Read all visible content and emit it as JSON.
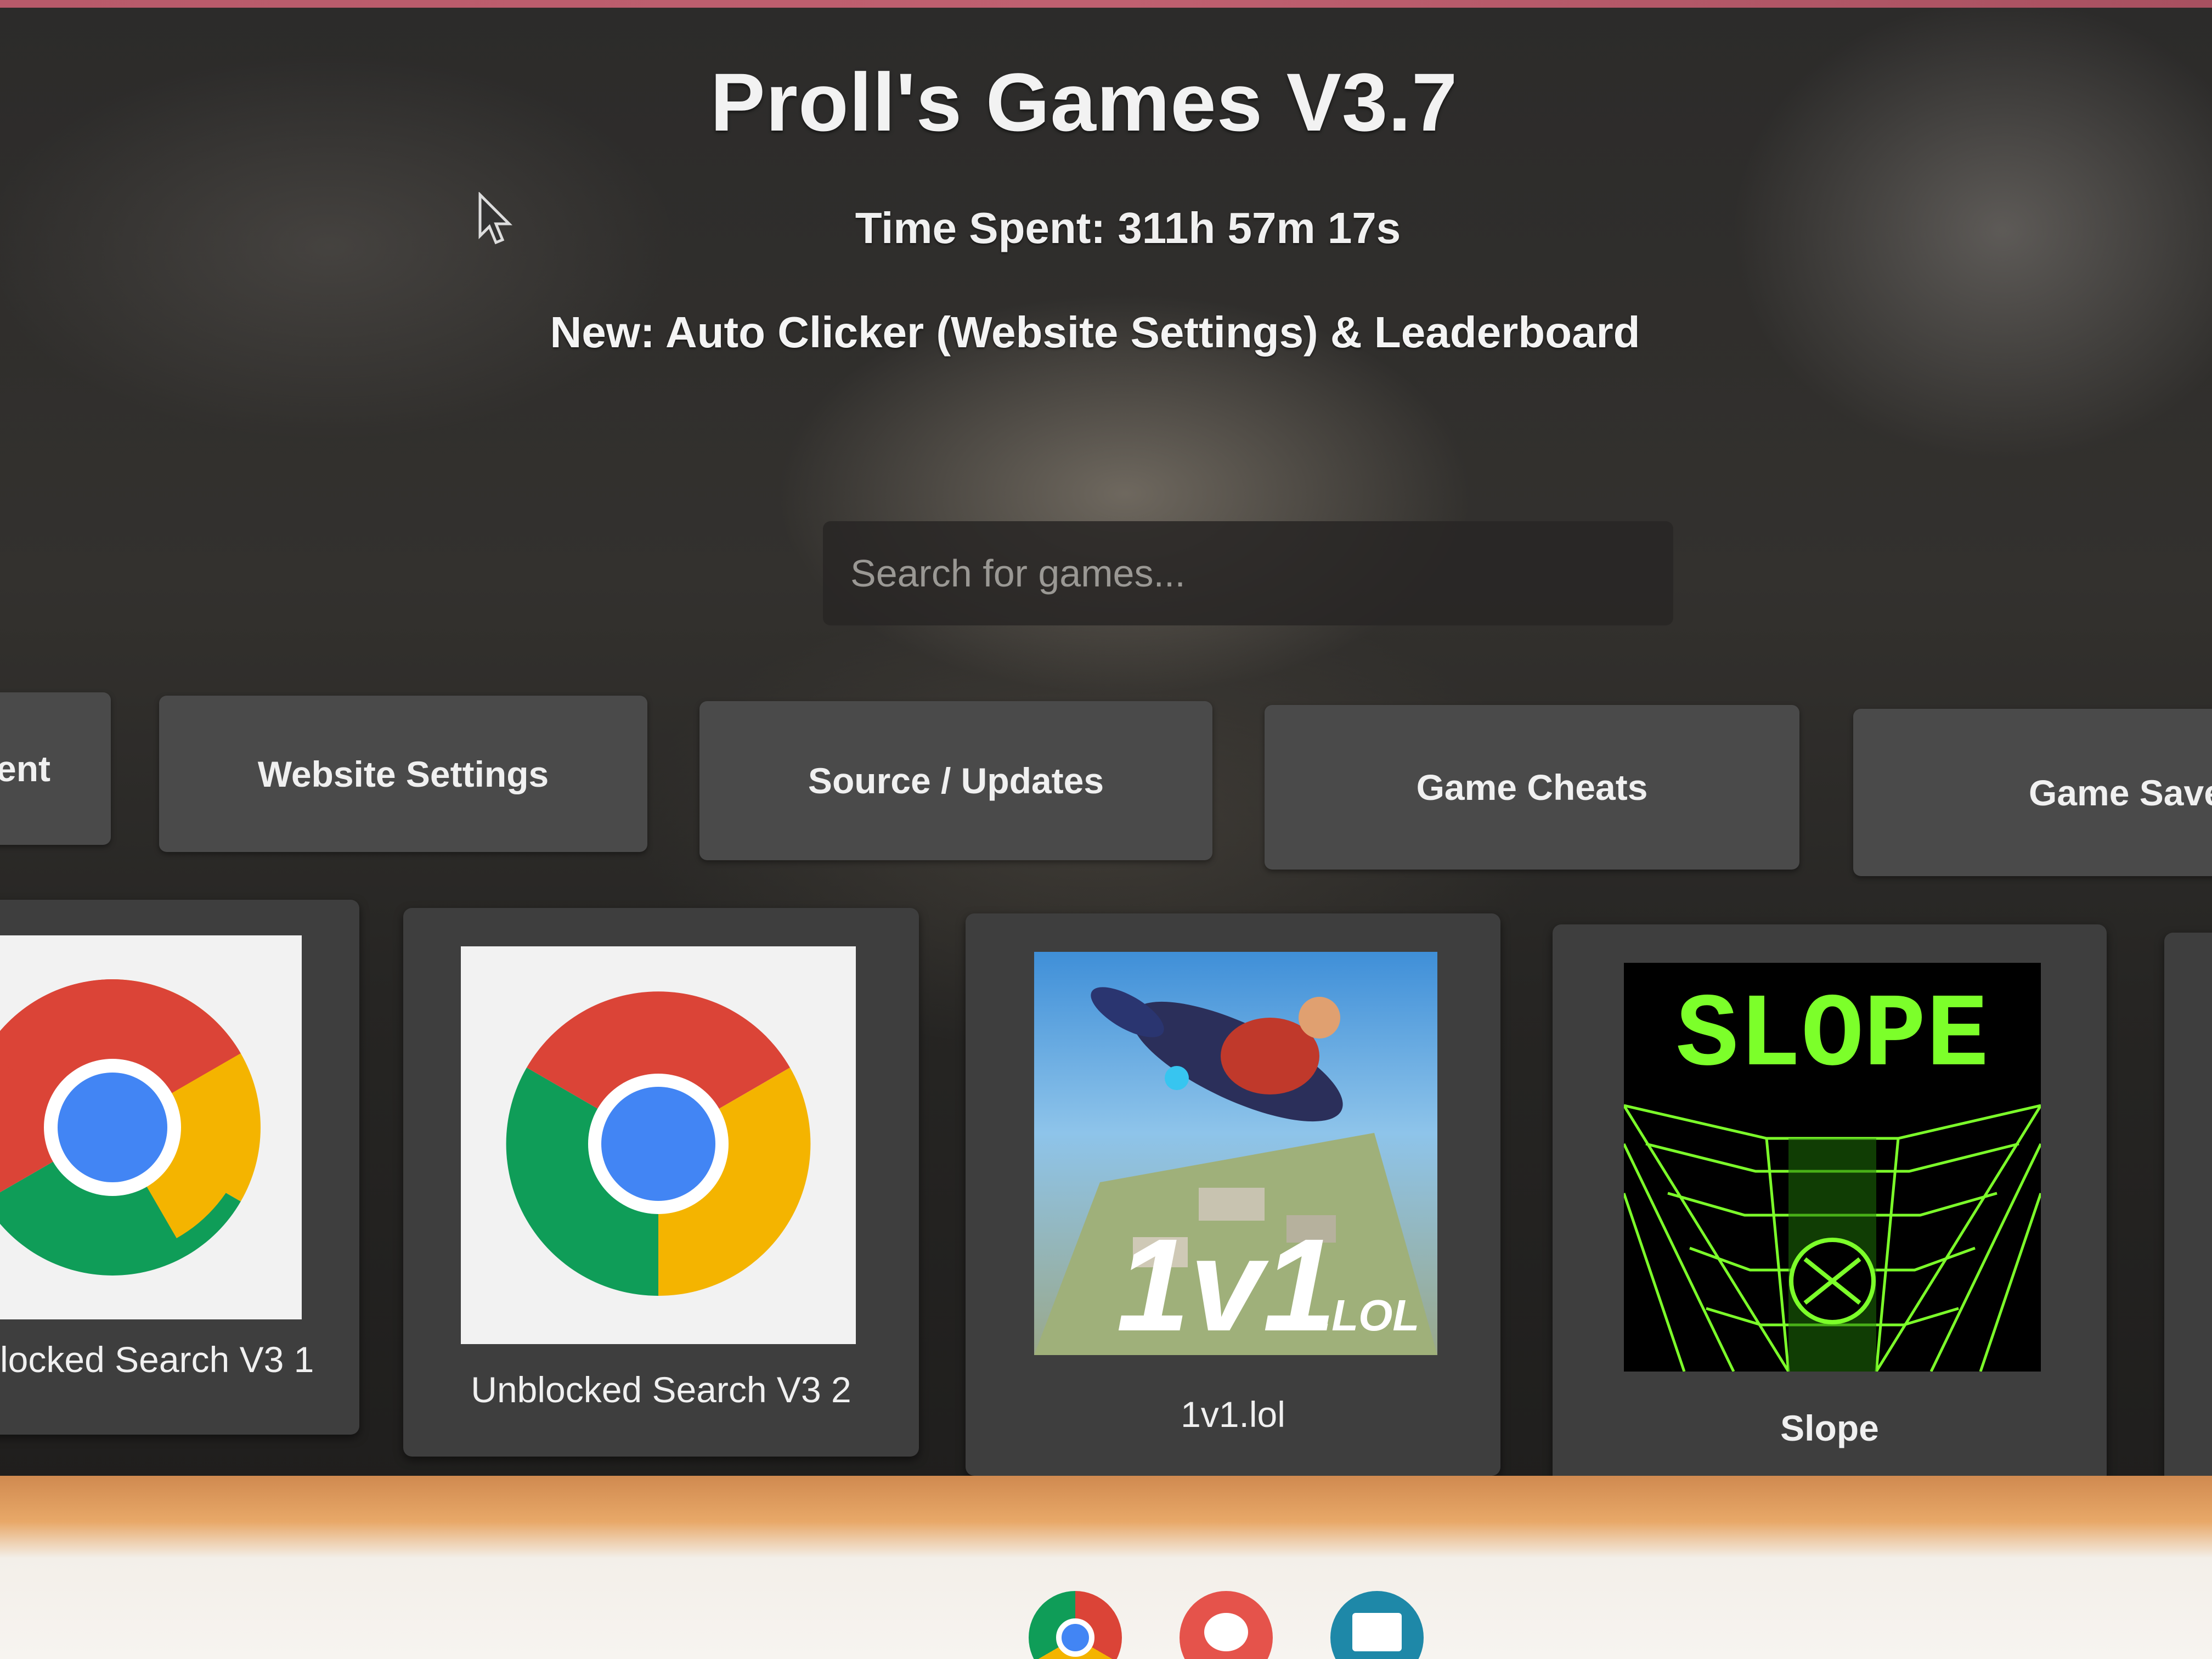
{
  "header": {
    "title": "Proll's Games V3.7",
    "time_spent_label": "Time Spent:",
    "time_spent_value": "311h 57m 17s",
    "news": "New: Auto Clicker (Website Settings) & Leaderboard"
  },
  "search": {
    "placeholder": "Search for games..."
  },
  "nav": {
    "buttons": [
      {
        "label": "rent"
      },
      {
        "label": "Website Settings"
      },
      {
        "label": "Source / Updates"
      },
      {
        "label": "Game Cheats"
      },
      {
        "label": "Game Save"
      }
    ]
  },
  "games": [
    {
      "title": "locked Search V3 1",
      "icon": "chrome-icon"
    },
    {
      "title": "Unblocked Search V3 2",
      "icon": "chrome-icon"
    },
    {
      "title": "1v1.lol",
      "icon": "1v1-lol-thumbnail",
      "thumb_text_main": "1v1",
      "thumb_text_sub": ".LOL"
    },
    {
      "title": "Slope",
      "icon": "slope-thumbnail",
      "thumb_text": "SLOPE"
    }
  ],
  "shelf": {
    "apps": [
      "chrome-icon",
      "paint-icon",
      "news-icon"
    ]
  },
  "colors": {
    "background": "#2c2b2a",
    "button": "#4a4a4a",
    "card": "#3e3e3e",
    "slope_green": "#7cff2a",
    "chrome_red": "#db4437",
    "chrome_green": "#0f9d58",
    "chrome_yellow": "#f4b400",
    "chrome_blue": "#4285f4"
  }
}
